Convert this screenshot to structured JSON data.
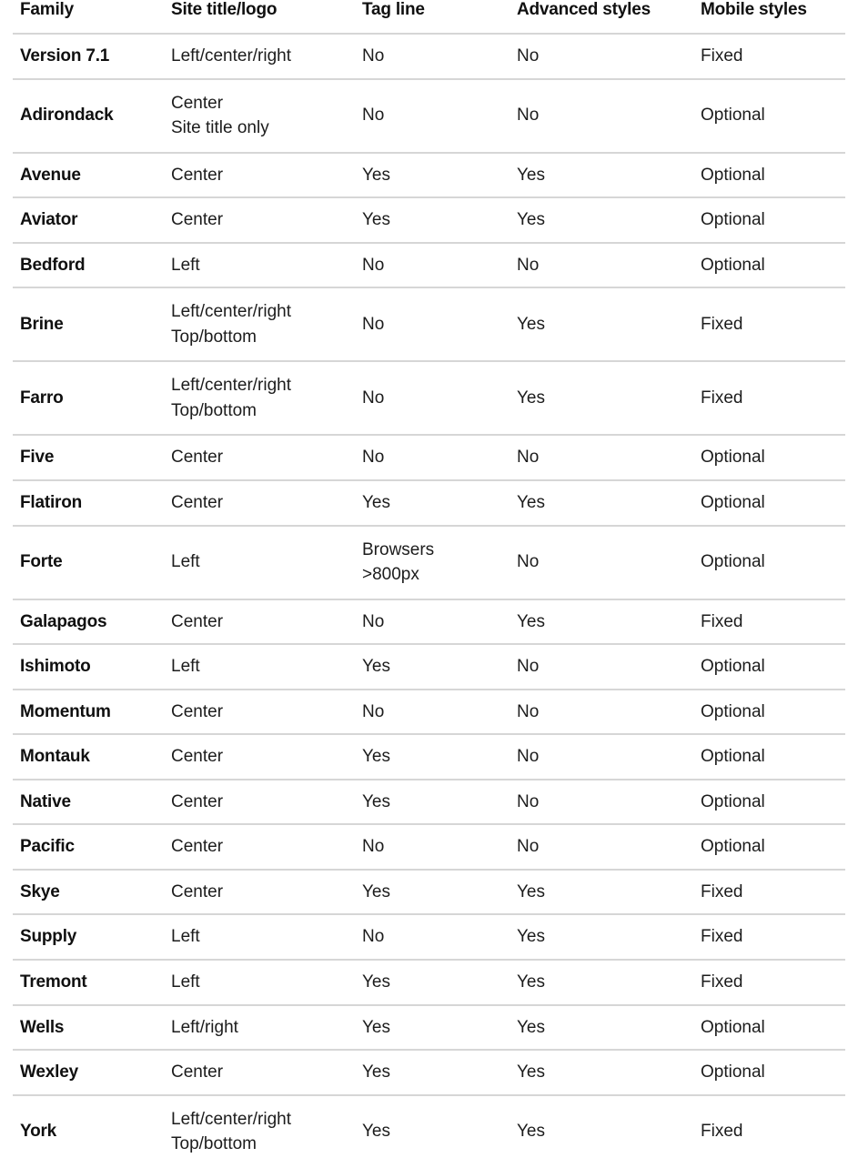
{
  "table": {
    "columns": [
      {
        "key": "family",
        "label": "Family"
      },
      {
        "key": "site",
        "label": "Site title/logo"
      },
      {
        "key": "tag",
        "label": "Tag line"
      },
      {
        "key": "advanced",
        "label": "Advanced styles"
      },
      {
        "key": "mobile",
        "label": "Mobile styles"
      }
    ],
    "rows": [
      {
        "family": "Version 7.1",
        "site": "Left/center/right",
        "site_line2": "",
        "tag": "No",
        "tag_line2": "",
        "advanced": "No",
        "mobile": "Fixed"
      },
      {
        "family": "Adirondack",
        "site": "Center",
        "site_line2": "Site title only",
        "tag": "No",
        "tag_line2": "",
        "advanced": "No",
        "mobile": "Optional"
      },
      {
        "family": "Avenue",
        "site": "Center",
        "site_line2": "",
        "tag": "Yes",
        "tag_line2": "",
        "advanced": "Yes",
        "mobile": "Optional"
      },
      {
        "family": "Aviator",
        "site": "Center",
        "site_line2": "",
        "tag": "Yes",
        "tag_line2": "",
        "advanced": "Yes",
        "mobile": "Optional"
      },
      {
        "family": "Bedford",
        "site": "Left",
        "site_line2": "",
        "tag": "No",
        "tag_line2": "",
        "advanced": "No",
        "mobile": "Optional"
      },
      {
        "family": "Brine",
        "site": "Left/center/right",
        "site_line2": "Top/bottom",
        "tag": "No",
        "tag_line2": "",
        "advanced": "Yes",
        "mobile": "Fixed"
      },
      {
        "family": "Farro",
        "site": "Left/center/right",
        "site_line2": "Top/bottom",
        "tag": "No",
        "tag_line2": "",
        "advanced": "Yes",
        "mobile": "Fixed"
      },
      {
        "family": "Five",
        "site": "Center",
        "site_line2": "",
        "tag": "No",
        "tag_line2": "",
        "advanced": "No",
        "mobile": "Optional"
      },
      {
        "family": "Flatiron",
        "site": "Center",
        "site_line2": "",
        "tag": "Yes",
        "tag_line2": "",
        "advanced": "Yes",
        "mobile": "Optional"
      },
      {
        "family": "Forte",
        "site": "Left",
        "site_line2": "",
        "tag": "Browsers",
        "tag_line2": ">800px",
        "advanced": "No",
        "mobile": "Optional"
      },
      {
        "family": "Galapagos",
        "site": "Center",
        "site_line2": "",
        "tag": "No",
        "tag_line2": "",
        "advanced": "Yes",
        "mobile": "Fixed"
      },
      {
        "family": "Ishimoto",
        "site": "Left",
        "site_line2": "",
        "tag": "Yes",
        "tag_line2": "",
        "advanced": "No",
        "mobile": "Optional"
      },
      {
        "family": "Momentum",
        "site": "Center",
        "site_line2": "",
        "tag": "No",
        "tag_line2": "",
        "advanced": "No",
        "mobile": "Optional"
      },
      {
        "family": "Montauk",
        "site": "Center",
        "site_line2": "",
        "tag": "Yes",
        "tag_line2": "",
        "advanced": "No",
        "mobile": "Optional"
      },
      {
        "family": "Native",
        "site": "Center",
        "site_line2": "",
        "tag": "Yes",
        "tag_line2": "",
        "advanced": "No",
        "mobile": "Optional"
      },
      {
        "family": "Pacific",
        "site": "Center",
        "site_line2": "",
        "tag": "No",
        "tag_line2": "",
        "advanced": "No",
        "mobile": "Optional"
      },
      {
        "family": "Skye",
        "site": "Center",
        "site_line2": "",
        "tag": "Yes",
        "tag_line2": "",
        "advanced": "Yes",
        "mobile": "Fixed"
      },
      {
        "family": "Supply",
        "site": "Left",
        "site_line2": "",
        "tag": "No",
        "tag_line2": "",
        "advanced": "Yes",
        "mobile": "Fixed"
      },
      {
        "family": "Tremont",
        "site": "Left",
        "site_line2": "",
        "tag": "Yes",
        "tag_line2": "",
        "advanced": "Yes",
        "mobile": "Fixed"
      },
      {
        "family": "Wells",
        "site": "Left/right",
        "site_line2": "",
        "tag": "Yes",
        "tag_line2": "",
        "advanced": "Yes",
        "mobile": "Optional"
      },
      {
        "family": "Wexley",
        "site": "Center",
        "site_line2": "",
        "tag": "Yes",
        "tag_line2": "",
        "advanced": "Yes",
        "mobile": "Optional"
      },
      {
        "family": "York",
        "site": "Left/center/right",
        "site_line2": "Top/bottom",
        "tag": "Yes",
        "tag_line2": "",
        "advanced": "Yes",
        "mobile": "Fixed"
      }
    ]
  },
  "colors": {
    "text": "#1c1c1c",
    "heading": "#101010",
    "rule": "#d6d6d6",
    "background": "#ffffff"
  }
}
